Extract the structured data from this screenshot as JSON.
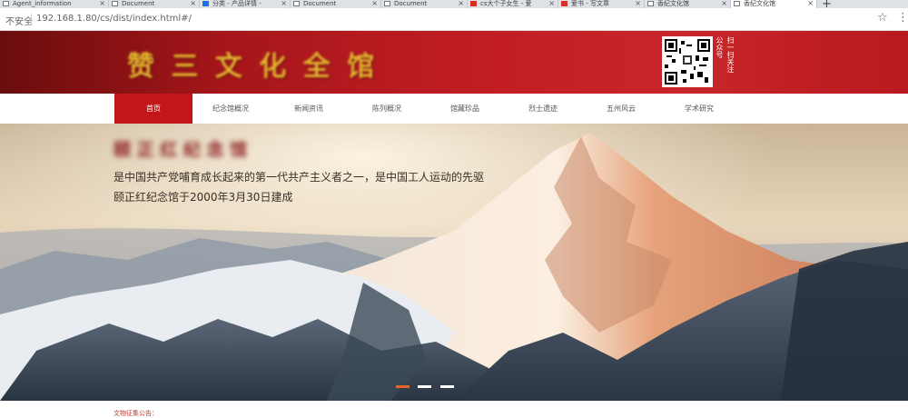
{
  "browser": {
    "tabs": [
      {
        "label": "Agent_information",
        "favicon": "doc-icon"
      },
      {
        "label": "Document",
        "favicon": "doc-icon"
      },
      {
        "label": "分类 - 产品详情 - ",
        "favicon": "blue-icon"
      },
      {
        "label": "Document",
        "favicon": "doc-icon"
      },
      {
        "label": "Document",
        "favicon": "doc-icon"
      },
      {
        "label": "cs大个子女生 - 爱",
        "favicon": "red-icon"
      },
      {
        "label": "爱书 - 写文章",
        "favicon": "red-icon"
      },
      {
        "label": "香纪文化馆",
        "favicon": "doc-icon"
      },
      {
        "label": "香纪文化馆",
        "favicon": "doc-icon",
        "active": true
      }
    ],
    "new_tab": "+",
    "secure_label": "不安全",
    "url": "192.168.1.80/cs/dist/index.html#/",
    "star": "☆",
    "menu": "⋮"
  },
  "banner": {
    "logo_text": "赞 三 文 化 全 馆",
    "qr_caption": [
      "扫一扫关注",
      "公众号"
    ]
  },
  "nav": {
    "items": [
      {
        "label": "首页",
        "active": true
      },
      {
        "label": "纪念馆概况"
      },
      {
        "label": "新闻资讯"
      },
      {
        "label": "陈列概况"
      },
      {
        "label": "馆藏珍品"
      },
      {
        "label": "烈士遗迹"
      },
      {
        "label": "五州风云"
      },
      {
        "label": "学术研究"
      }
    ]
  },
  "hero": {
    "title": "颐 正 红 纪 念 馆",
    "line1": "是中国共产党哺育成长起来的第一代共产主义者之一，是中国工人运动的先驱",
    "line2": "颐正红纪念馆于2000年3月30日建成",
    "slide_count": 3,
    "active_slide": 0
  },
  "notice": "文物征集公告："
}
